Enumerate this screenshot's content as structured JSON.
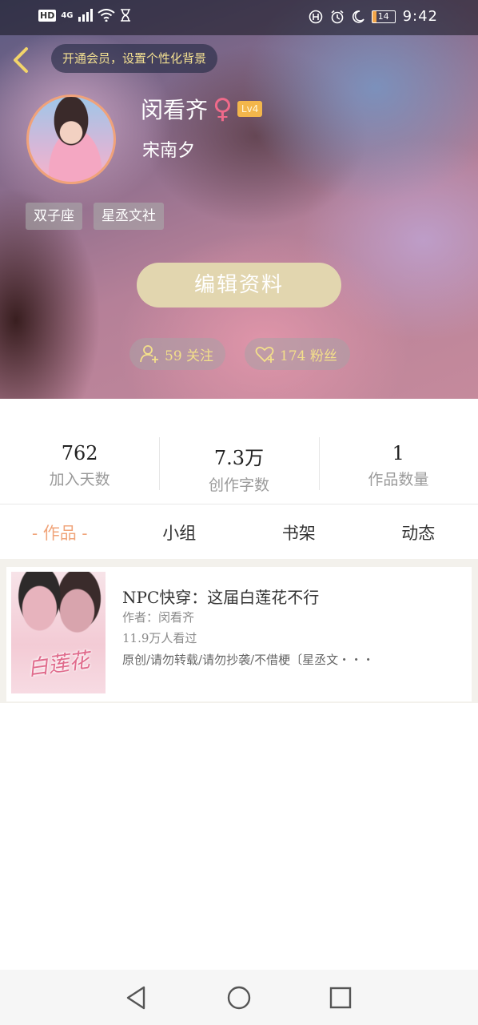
{
  "status_bar": {
    "hd": "HD",
    "network": "4G",
    "battery": "14",
    "time": "9:42",
    "icons": [
      "signal-icon",
      "wifi-icon",
      "hourglass-icon",
      "data-saver-icon",
      "alarm-icon",
      "moon-icon",
      "battery-icon"
    ]
  },
  "header": {
    "back_icon": "chevron-left-icon",
    "vip_banner": "开通会员，设置个性化背景"
  },
  "profile": {
    "name": "闵看齐",
    "gender_icon": "female-icon",
    "level": "Lv4",
    "subname": "宋南夕",
    "tags": [
      "双子座",
      "星丞文社"
    ],
    "edit_button": "编辑资料",
    "follow_label": "59 关注",
    "fans_label": "174 粉丝"
  },
  "stats": [
    {
      "value": "762",
      "label": "加入天数"
    },
    {
      "value": "7.3万",
      "label": "创作字数"
    },
    {
      "value": "1",
      "label": "作品数量"
    }
  ],
  "tabs": [
    {
      "label": "- 作品 -",
      "active": true
    },
    {
      "label": "小组",
      "active": false
    },
    {
      "label": "书架",
      "active": false
    },
    {
      "label": "动态",
      "active": false
    }
  ],
  "works": [
    {
      "title": "NPC快穿：这届白莲花不行",
      "author": "作者：闵看齐",
      "views": "11.9万人看过",
      "description": "原创/请勿转载/请勿抄袭/不借梗〔星丞文・・・",
      "cover_text": "白莲花"
    }
  ],
  "colors": {
    "accent": "#f0a47a",
    "gold": "#f3df8a",
    "edit_button": "#e2d6af",
    "level_badge": "#f3b64b"
  }
}
